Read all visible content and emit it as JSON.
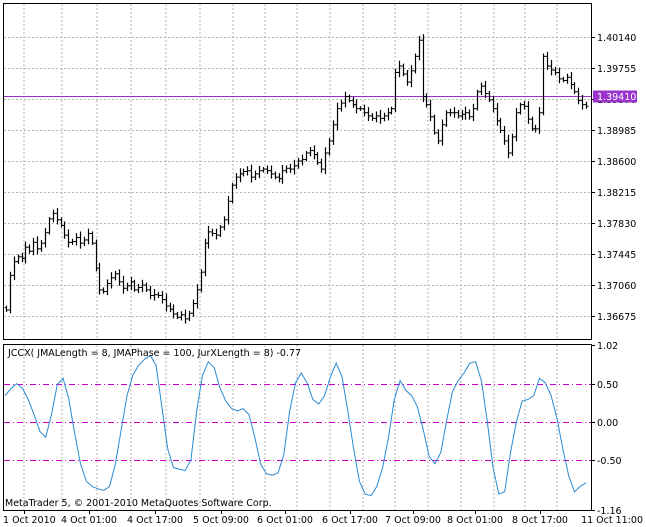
{
  "chart_data": [
    {
      "type": "bar",
      "subtype": "ohlc",
      "pane": "main",
      "y_ticks": [
        "1.40140",
        "1.39755",
        "1.39370",
        "1.38985",
        "1.38600",
        "1.38215",
        "1.37830",
        "1.37445",
        "1.37060",
        "1.36675"
      ],
      "ylim": [
        1.3639,
        1.4055
      ],
      "grid": true,
      "current_price": {
        "label": "1.39410",
        "value": 1.3941,
        "color": "#9933cc"
      },
      "bar_color": "#000000",
      "closes": [
        1.3675,
        1.3718,
        1.3735,
        1.3741,
        1.3739,
        1.3753,
        1.3748,
        1.3759,
        1.3751,
        1.3758,
        1.3771,
        1.3788,
        1.3795,
        1.3787,
        1.378,
        1.3768,
        1.3759,
        1.376,
        1.3765,
        1.3758,
        1.3762,
        1.377,
        1.3758,
        1.3727,
        1.37,
        1.3698,
        1.3708,
        1.3715,
        1.372,
        1.371,
        1.3702,
        1.3705,
        1.371,
        1.37,
        1.3703,
        1.3706,
        1.37,
        1.3693,
        1.3694,
        1.3693,
        1.3688,
        1.368,
        1.3676,
        1.367,
        1.3666,
        1.3669,
        1.3664,
        1.3671,
        1.3683,
        1.37,
        1.3722,
        1.3758,
        1.3772,
        1.377,
        1.3768,
        1.3778,
        1.3787,
        1.381,
        1.383,
        1.384,
        1.3844,
        1.3847,
        1.3848,
        1.384,
        1.3844,
        1.3848,
        1.385,
        1.3848,
        1.3844,
        1.384,
        1.3838,
        1.3848,
        1.3851,
        1.385,
        1.3854,
        1.386,
        1.3862,
        1.387,
        1.3873,
        1.3868,
        1.3858,
        1.385,
        1.387,
        1.3885,
        1.3905,
        1.3925,
        1.3932,
        1.394,
        1.3935,
        1.393,
        1.3925,
        1.3925,
        1.392,
        1.3916,
        1.3913,
        1.3916,
        1.3913,
        1.3916,
        1.392,
        1.3925,
        1.397,
        1.3978,
        1.3968,
        1.3958,
        1.3972,
        1.399,
        1.401,
        1.394,
        1.393,
        1.3915,
        1.3895,
        1.3885,
        1.3905,
        1.392,
        1.392,
        1.392,
        1.3916,
        1.3918,
        1.392,
        1.3915,
        1.3925,
        1.3946,
        1.3953,
        1.3944,
        1.3936,
        1.3925,
        1.391,
        1.3898,
        1.3885,
        1.387,
        1.389,
        1.392,
        1.393,
        1.3928,
        1.3912,
        1.39,
        1.39,
        1.392,
        1.399,
        1.3978,
        1.3973,
        1.397,
        1.3962,
        1.396,
        1.3964,
        1.3955,
        1.3946,
        1.3935,
        1.393,
        1.3928
      ]
    },
    {
      "type": "line",
      "pane": "indicator",
      "title": "JCCX( JMALength = 8, JMAPhase = 100, JurXLength = 8) -0.77",
      "y_ticks": [
        "1.02",
        "0.50",
        "0.00",
        "-0.50",
        "-1.16"
      ],
      "ylim": [
        -1.16,
        1.02
      ],
      "levels": [
        0.5,
        0.0,
        -0.5
      ],
      "level_color": "#cc00cc",
      "line_color": "#2a8ad2",
      "values": [
        0.35,
        0.44,
        0.51,
        0.45,
        0.3,
        0.1,
        -0.12,
        -0.2,
        0.1,
        0.5,
        0.58,
        0.3,
        -0.15,
        -0.55,
        -0.78,
        -0.85,
        -0.88,
        -0.9,
        -0.85,
        -0.55,
        -0.1,
        0.35,
        0.62,
        0.75,
        0.83,
        0.88,
        0.75,
        0.2,
        -0.35,
        -0.6,
        -0.62,
        -0.64,
        -0.5,
        0.15,
        0.62,
        0.8,
        0.72,
        0.45,
        0.28,
        0.18,
        0.15,
        0.18,
        0.1,
        -0.2,
        -0.55,
        -0.68,
        -0.7,
        -0.67,
        -0.42,
        0.15,
        0.52,
        0.65,
        0.52,
        0.3,
        0.24,
        0.35,
        0.6,
        0.78,
        0.6,
        0.15,
        -0.35,
        -0.78,
        -0.95,
        -0.97,
        -0.85,
        -0.6,
        -0.2,
        0.3,
        0.55,
        0.42,
        0.35,
        0.2,
        -0.1,
        -0.45,
        -0.55,
        -0.4,
        0.02,
        0.4,
        0.55,
        0.65,
        0.78,
        0.8,
        0.55,
        0.02,
        -0.6,
        -0.95,
        -0.92,
        -0.4,
        0.0,
        0.28,
        0.3,
        0.35,
        0.58,
        0.52,
        0.35,
        0.05,
        -0.35,
        -0.7,
        -0.92,
        -0.85,
        -0.8
      ]
    }
  ],
  "x_axis": {
    "labels": [
      "1 Oct 2010",
      "4 Oct 01:00",
      "4 Oct 17:00",
      "5 Oct 09:00",
      "6 Oct 01:00",
      "6 Oct 17:00",
      "7 Oct 09:00",
      "8 Oct 01:00",
      "8 Oct 17:00",
      "11 Oct 11:00"
    ]
  },
  "footer": {
    "copyright": "MetaTrader 5, © 2001-2010 MetaQuotes Software Corp."
  },
  "colors": {
    "grid": "#b4b4b4",
    "frame": "#000000",
    "background": "#ffffff"
  }
}
